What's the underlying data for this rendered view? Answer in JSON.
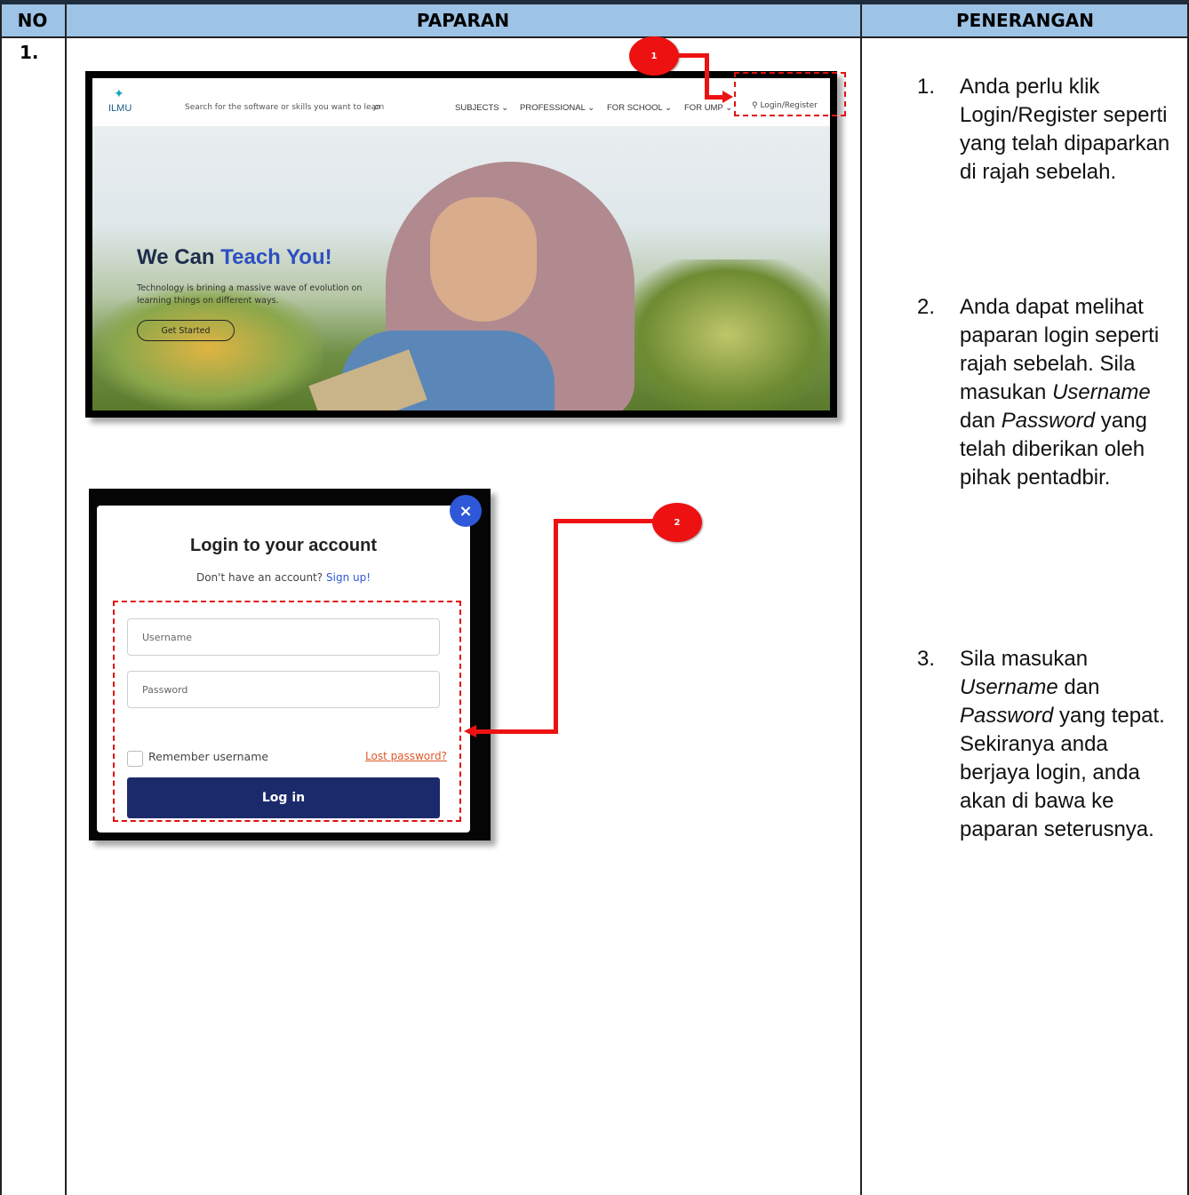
{
  "table": {
    "headers": [
      "NO",
      "PAPARAN",
      "PENERANGAN"
    ],
    "row_number": "1."
  },
  "site": {
    "logo_text": "ILMU",
    "search_placeholder": "Search for the software or skills you want to learn",
    "nav": [
      "SUBJECTS ⌄",
      "PROFESSIONAL ⌄",
      "FOR SCHOOL ⌄",
      "FOR UMP ⌄"
    ],
    "login_register": "Login/Register",
    "hero_title_plain": "We Can ",
    "hero_title_accent": "Teach You!",
    "hero_subtitle": "Technology is brining a massive wave of evolution on learning things on different ways.",
    "hero_button": "Get Started"
  },
  "login_modal": {
    "close": "×",
    "title": "Login to your account",
    "signup_prompt": "Don't have an account?",
    "signup_link": "Sign up!",
    "username_placeholder": "Username",
    "password_placeholder": "Password",
    "remember_label": "Remember username",
    "lost_password": "Lost password?",
    "login_button": "Log in"
  },
  "annotations": {
    "badge_1": "1",
    "badge_2": "2"
  },
  "penerangan": {
    "step1_num": "1.",
    "step1": "Anda perlu klik Login/Register seperti yang telah dipaparkan di rajah sebelah.",
    "step2_num": "2.",
    "step2_a": "Anda dapat melihat paparan login seperti rajah sebelah. Sila masukan ",
    "step2_username": "Username",
    "step2_b": " dan ",
    "step2_password": "Password",
    "step2_c": " yang telah diberikan oleh pihak pentadbir.",
    "step3_num": "3.",
    "step3_a": "Sila masukan ",
    "step3_username": "Username",
    "step3_b": " dan ",
    "step3_password": "Password",
    "step3_c": " yang tepat. Sekiranya anda berjaya login, anda akan di bawa ke paparan seterusnya."
  },
  "colors": {
    "header_bg": "#9dc3e6",
    "annotation_red": "#ee1111",
    "login_button_bg": "#1b2a6b",
    "accent_blue": "#2f58d9"
  }
}
